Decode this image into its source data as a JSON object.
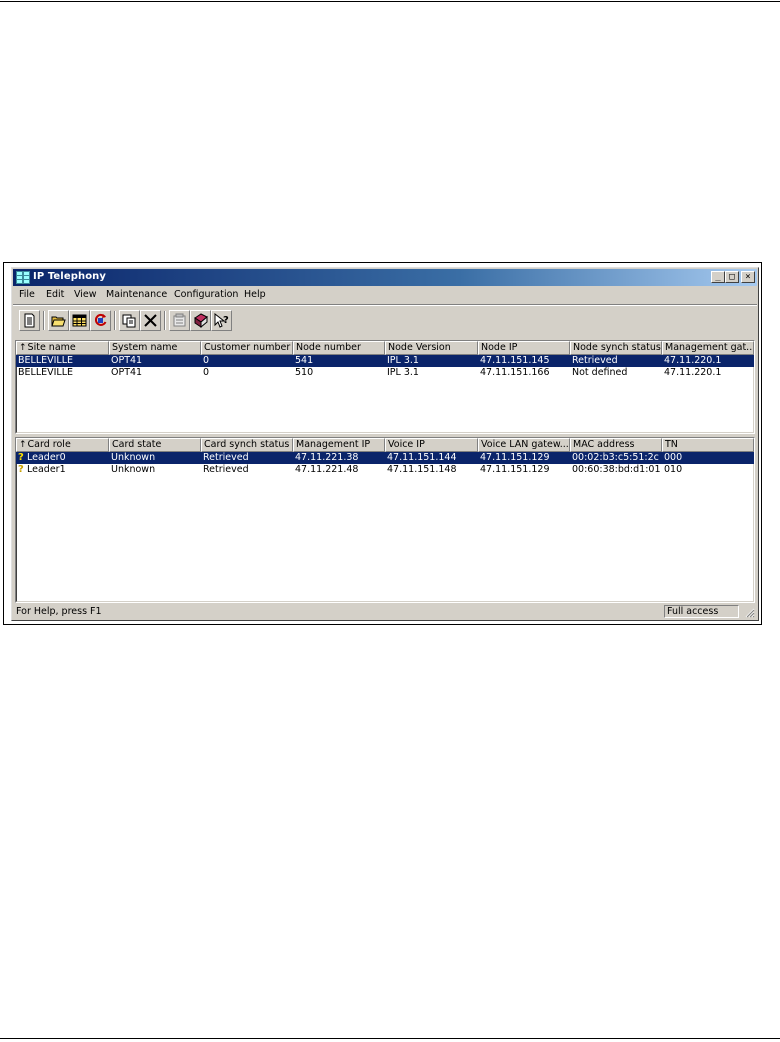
{
  "window": {
    "title": "IP Telephony",
    "minimize_glyph": "_",
    "maximize_glyph": "□",
    "close_glyph": "×"
  },
  "menu": [
    "File",
    "Edit",
    "View",
    "Maintenance",
    "Configuration",
    "Help"
  ],
  "toolbar": {
    "buttons": [
      "new-icon",
      "open-icon",
      "grid-icon",
      "refresh-icon",
      "copy-icon",
      "delete-icon",
      "properties-icon",
      "book-icon",
      "context-help-icon"
    ]
  },
  "nodes_table": {
    "sort_glyph": "↑",
    "columns": [
      "Site name",
      "System name",
      "Customer number",
      "Node number",
      "Node Version",
      "Node IP",
      "Node synch status",
      "Management gat..."
    ],
    "rows": [
      [
        "BELLEVILLE",
        "OPT41",
        "0",
        "541",
        "IPL 3.1",
        "47.11.151.145",
        "Retrieved",
        "47.11.220.1"
      ],
      [
        "BELLEVILLE",
        "OPT41",
        "0",
        "510",
        "IPL 3.1",
        "47.11.151.166",
        "Not defined",
        "47.11.220.1"
      ]
    ],
    "selected_row": 0
  },
  "cards_table": {
    "sort_glyph": "↑",
    "columns": [
      "Card role",
      "Card state",
      "Card synch status",
      "Management IP",
      "Voice IP",
      "Voice LAN gatew...",
      "MAC address",
      "TN"
    ],
    "rows": [
      [
        "Leader0",
        "Unknown",
        "Retrieved",
        "47.11.221.38",
        "47.11.151.144",
        "47.11.151.129",
        "00:02:b3:c5:51:2c",
        "000"
      ],
      [
        "Leader1",
        "Unknown",
        "Retrieved",
        "47.11.221.48",
        "47.11.151.148",
        "47.11.151.129",
        "00:60:38:bd:d1:01",
        "010"
      ]
    ],
    "row_icon_glyph": "?",
    "selected_row": 0
  },
  "statusbar": {
    "help_text": "For Help, press F1",
    "access": "Full access"
  },
  "colors": {
    "selection": "#0a246a",
    "title_gradient_start": "#0a246a",
    "title_gradient_end": "#a6caf0",
    "face": "#d4d0c8"
  }
}
